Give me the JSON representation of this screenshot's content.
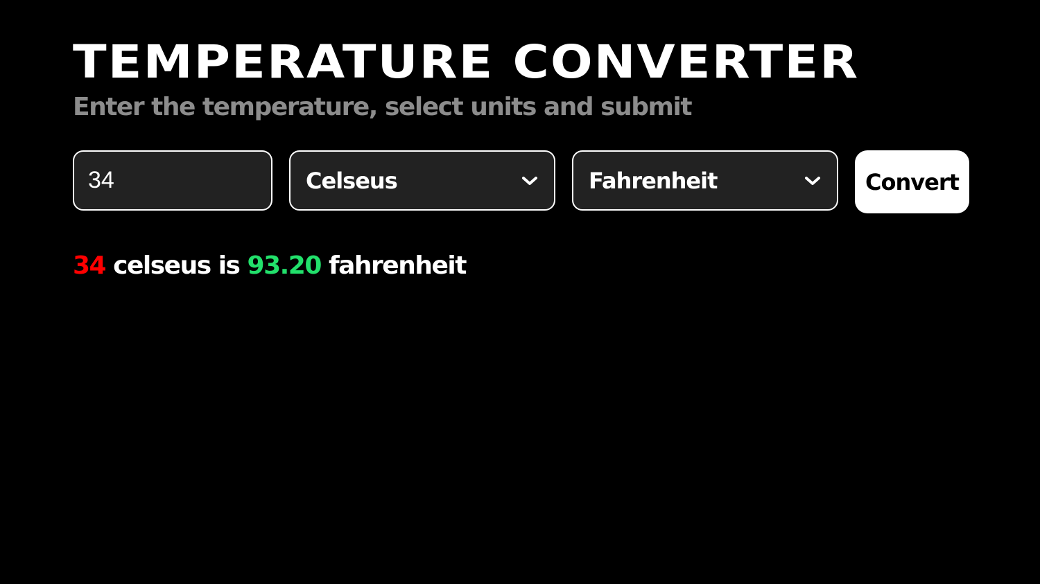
{
  "header": {
    "title": "Temperature Converter",
    "subtitle": "Enter the temperature, select units and submit"
  },
  "form": {
    "temperature_value": "34",
    "from_unit": "Celseus",
    "to_unit": "Fahrenheit",
    "convert_label": "Convert"
  },
  "result": {
    "input_value": "34",
    "input_unit": "celseus",
    "connector": "is",
    "output_value": "93.20",
    "output_unit": "fahrenheit"
  },
  "colors": {
    "background": "#000000",
    "field_background": "#222222",
    "input_number": "#ff0000",
    "output_number": "#22e06b",
    "subtitle": "#8c8c8c"
  },
  "icons": {
    "dropdown": "chevron-down-icon"
  }
}
